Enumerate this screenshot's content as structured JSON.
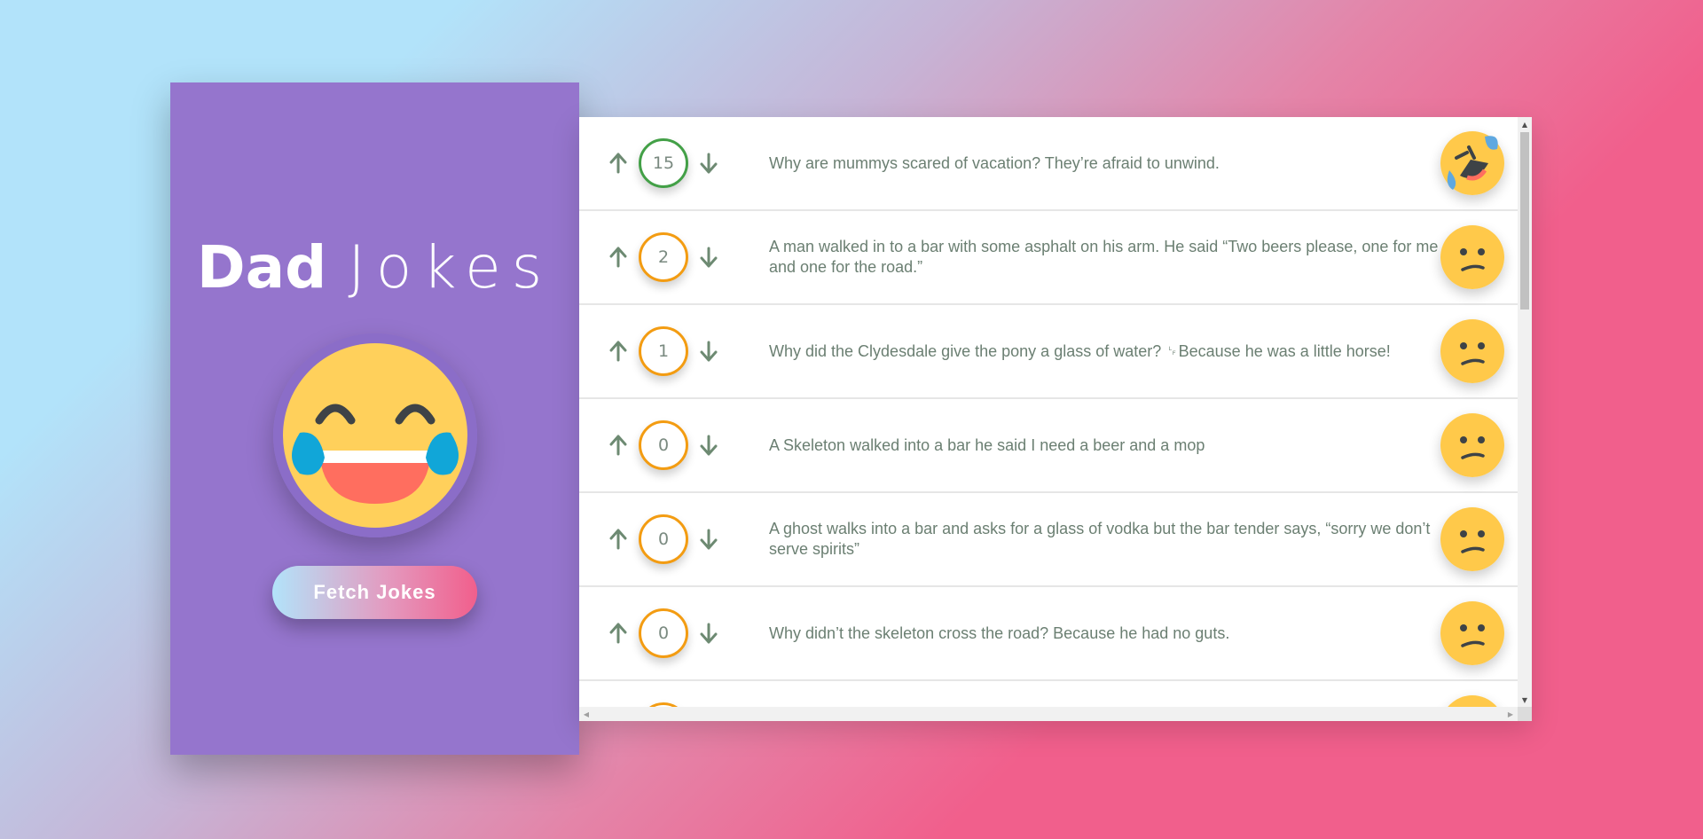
{
  "app": {
    "title_bold": "Dad",
    "title_light": "Jokes",
    "fetch_button": "Fetch Jokes"
  },
  "colors": {
    "sidebar": "#9575cd",
    "vote_border_top": "#43a047",
    "vote_border_default": "#f39c12",
    "joke_text": "#6b7f72"
  },
  "jokes": [
    {
      "votes": "15",
      "text": "Why are mummys scared of vacation? They’re afraid to unwind.",
      "reaction": "rolling-on-floor-laughing-icon"
    },
    {
      "votes": "2",
      "text": "A man walked in to a bar with some asphalt on his arm. He said “Two beers please, one for me and one for the road.”",
      "reaction": "confused-face-icon"
    },
    {
      "votes": "1",
      "text": "Why did the Clydesdale give the pony a glass of water? ␊Because he was a little horse!",
      "reaction": "confused-face-icon"
    },
    {
      "votes": "0",
      "text": "A Skeleton walked into a bar he said I need a beer and a mop",
      "reaction": "confused-face-icon"
    },
    {
      "votes": "0",
      "text": "A ghost walks into a bar and asks for a glass of vodka but the bar tender says, “sorry we don’t serve spirits”",
      "reaction": "confused-face-icon"
    },
    {
      "votes": "0",
      "text": "Why didn’t the skeleton cross the road? Because he had no guts.",
      "reaction": "confused-face-icon"
    }
  ]
}
